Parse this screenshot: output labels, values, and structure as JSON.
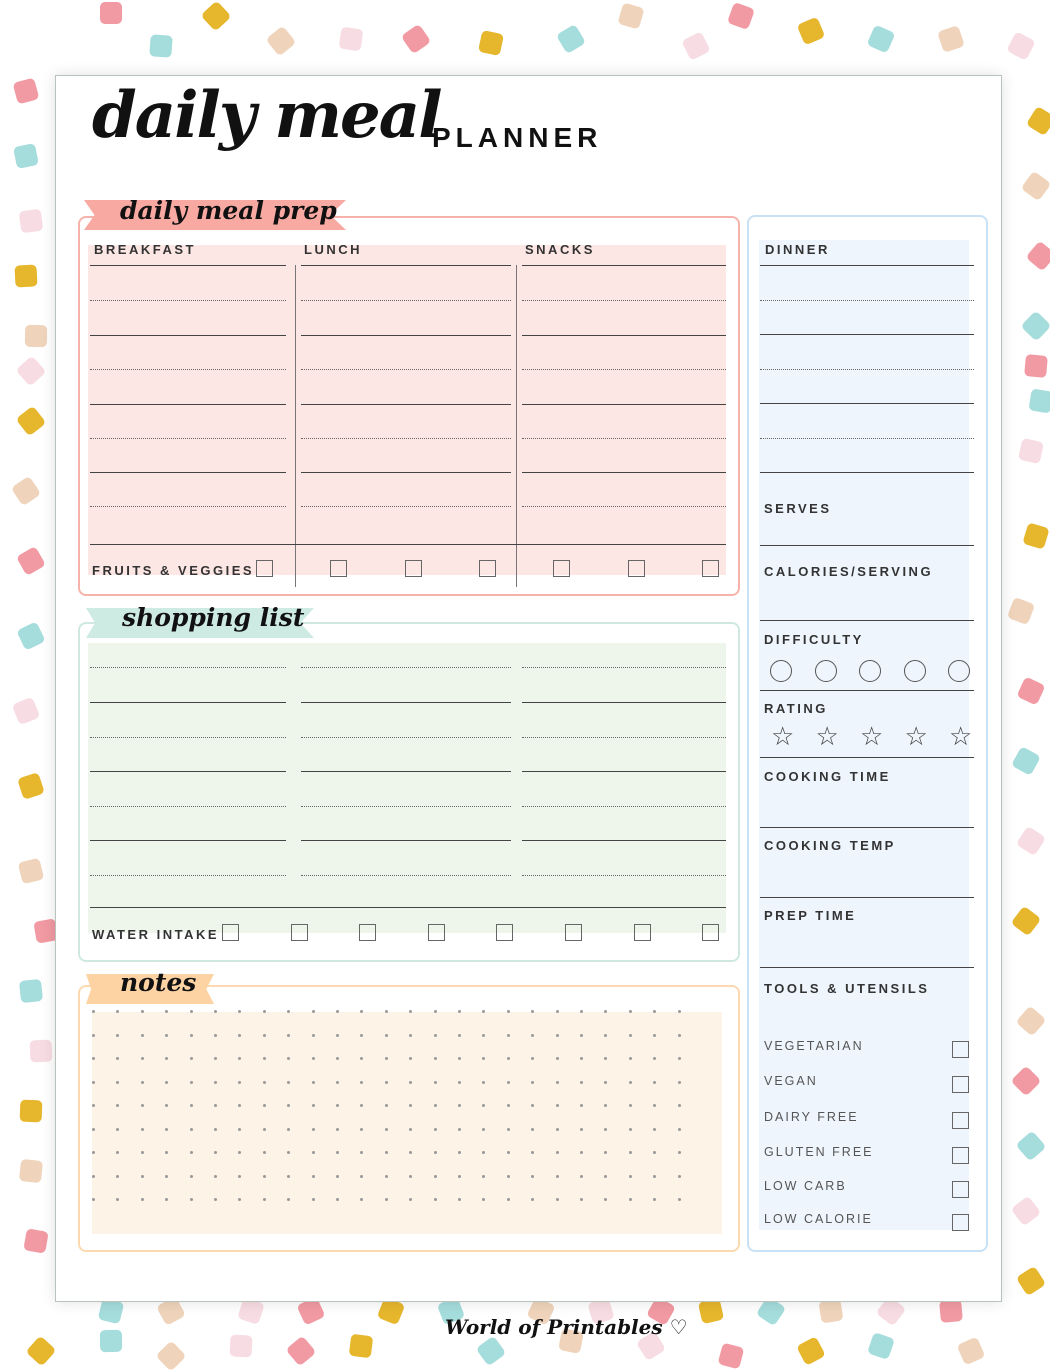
{
  "header": {
    "title_script": "daily meal",
    "title_caps": "PLANNER"
  },
  "colors": {
    "pink": "#f7a9a2",
    "pink_wash": "#fde7e4",
    "mint": "#cdeae3",
    "green_wash": "#eef6ec",
    "peach": "#fdd3a4",
    "peach_wash": "#fdf3e7",
    "blue_border": "#c9e1f4",
    "blue_wash": "#eef5fd"
  },
  "meal_prep": {
    "ribbon": "daily meal prep",
    "columns": [
      "BREAKFAST",
      "LUNCH",
      "SNACKS"
    ],
    "fruits_label": "FRUITS & VEGGIES",
    "fruits_checkbox_count": 7
  },
  "shopping": {
    "ribbon": "shopping list",
    "water_label": "WATER INTAKE",
    "water_checkbox_count": 8
  },
  "notes": {
    "ribbon": "notes"
  },
  "side": {
    "dinner": "DINNER",
    "serves": "SERVES",
    "calories": "CALORIES/SERVING",
    "difficulty": "DIFFICULTY",
    "difficulty_count": 5,
    "rating": "RATING",
    "rating_count": 5,
    "cooking_time": "COOKING TIME",
    "cooking_temp": "COOKING TEMP",
    "prep_time": "PREP TIME",
    "tools": "TOOLS & UTENSILS",
    "diet_options": [
      "VEGETARIAN",
      "VEGAN",
      "DAIRY FREE",
      "GLUTEN FREE",
      "LOW CARB",
      "LOW CALORIE"
    ]
  },
  "footer": {
    "brand": "World of Printables",
    "heart_icon": "♡"
  }
}
